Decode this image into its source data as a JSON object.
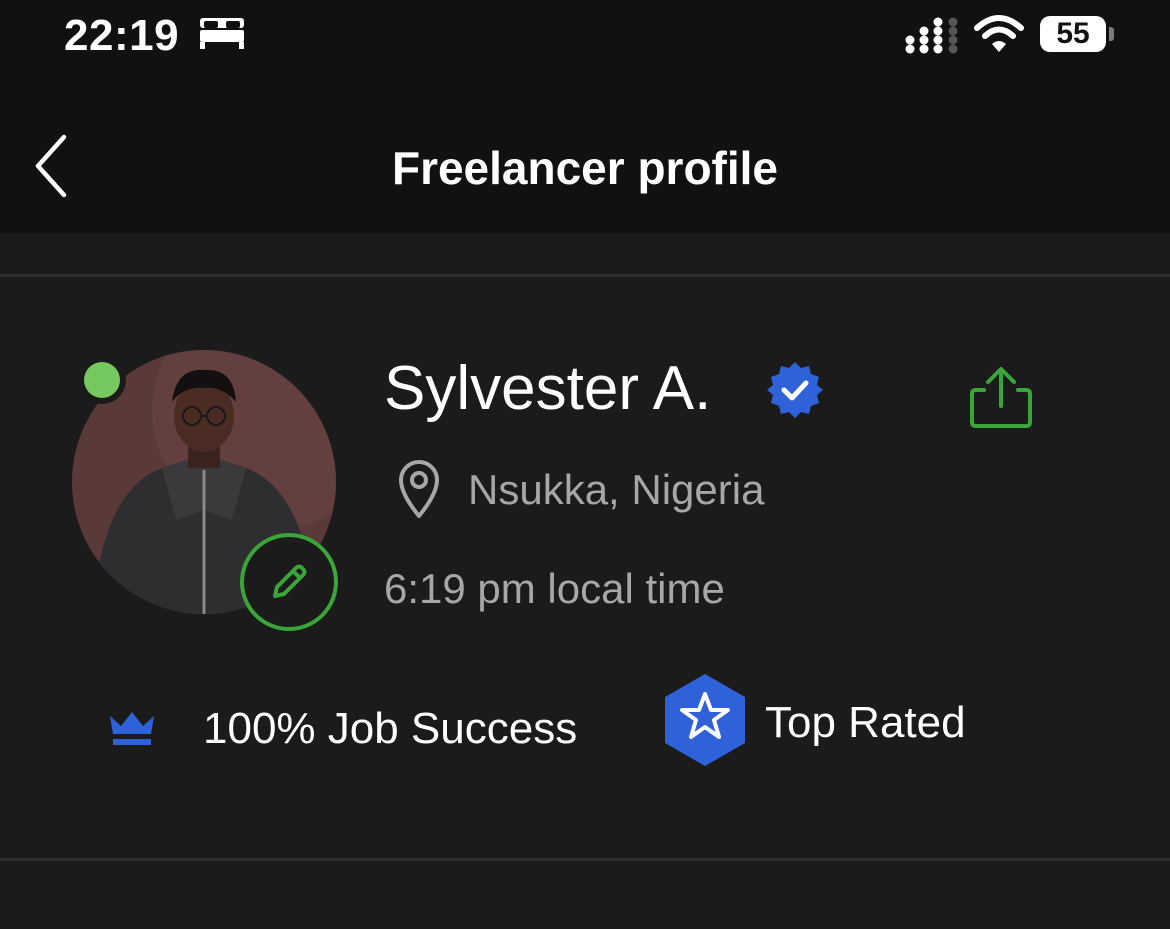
{
  "status_bar": {
    "time": "22:19",
    "battery": "55",
    "focus_icon": "bed-icon",
    "signal_icon": "cellular-signal-icon",
    "wifi_icon": "wifi-icon"
  },
  "nav": {
    "title": "Freelancer profile",
    "back_icon": "chevron-left-icon"
  },
  "profile": {
    "name": "Sylvester A.",
    "verified": true,
    "online": true,
    "location": "Nsukka, Nigeria",
    "local_time": "6:19 pm local time",
    "job_success": "100% Job Success",
    "badge": "Top Rated"
  },
  "colors": {
    "accent_green": "#3aa63a",
    "online_green": "#75c95e",
    "badge_blue": "#2f62d8",
    "background": "#1b1b1b",
    "header_background": "#111111",
    "secondary_text": "#a7a7a7"
  }
}
